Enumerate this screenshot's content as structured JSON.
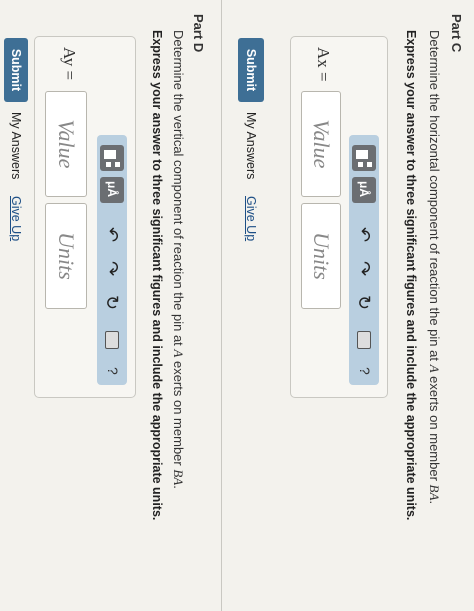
{
  "part_c": {
    "title": "Part C",
    "desc_pre": "Determine the horizontal component of reaction the pin at ",
    "desc_var1": "A",
    "desc_mid": " exerts on member ",
    "desc_var2": "BA",
    "desc_post": ".",
    "instruction": "Express your answer to three significant figures and include the appropriate units.",
    "label": "Ax =",
    "value_placeholder": "Value",
    "units_placeholder": "Units",
    "submit_label": "Submit",
    "my_answers": "My Answers",
    "give_up": "Give Up"
  },
  "part_d": {
    "title": "Part D",
    "desc_pre": "Determine the vertical component of reaction the pin at ",
    "desc_var1": "A",
    "desc_mid": " exerts on member ",
    "desc_var2": "BA",
    "desc_post": ".",
    "instruction": "Express your answer to three significant figures and include the appropriate units.",
    "label": "Ay =",
    "value_placeholder": "Value",
    "units_placeholder": "Units",
    "submit_label": "Submit",
    "my_answers": "My Answers",
    "give_up": "Give Up"
  },
  "toolbar": {
    "templates_icon": "templates-icon",
    "mu_label": "μÅ",
    "undo_icon": "undo-arrow-icon",
    "redo_icon": "redo-arrow-icon",
    "reset_icon": "reset-icon",
    "keyboard_icon": "keyboard-icon",
    "help_label": "?"
  },
  "colors": {
    "toolbar_bg": "#b9cfe0",
    "submit_bg": "#3e6f95",
    "link": "#1d4f86"
  }
}
